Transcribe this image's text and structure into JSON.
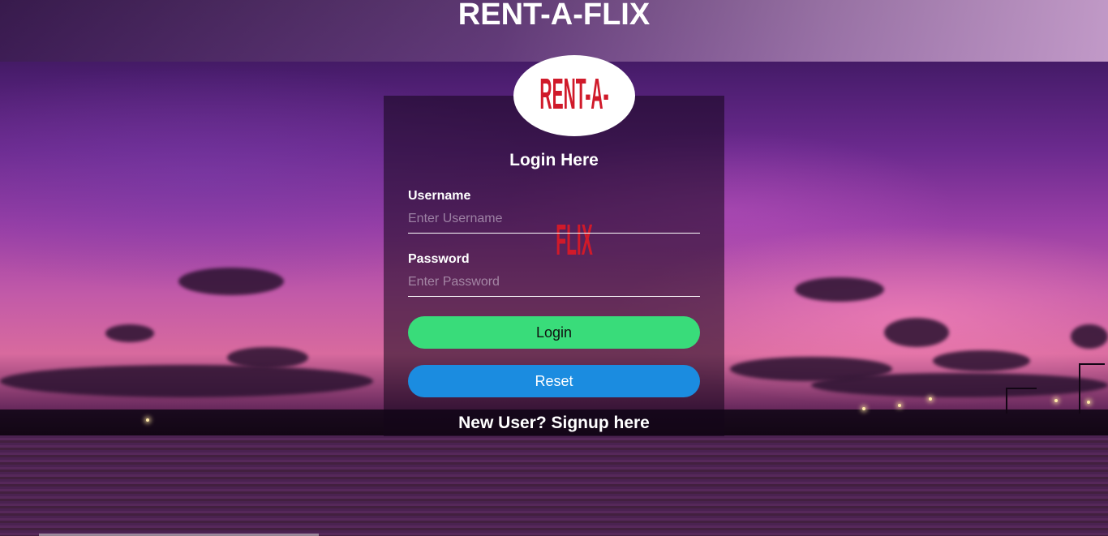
{
  "header": {
    "title": "RENT-A-FLIX"
  },
  "logo": {
    "text": "RENT-A-FLIX"
  },
  "login": {
    "heading": "Login Here",
    "username_label": "Username",
    "username_placeholder": "Enter Username",
    "password_label": "Password",
    "password_placeholder": "Enter Password",
    "login_button": "Login",
    "reset_button": "Reset",
    "signup_link": "New User? Signup here"
  },
  "colors": {
    "login_button": "#39dc7a",
    "reset_button": "#1b8ce0",
    "logo_text": "#d01a2a"
  }
}
